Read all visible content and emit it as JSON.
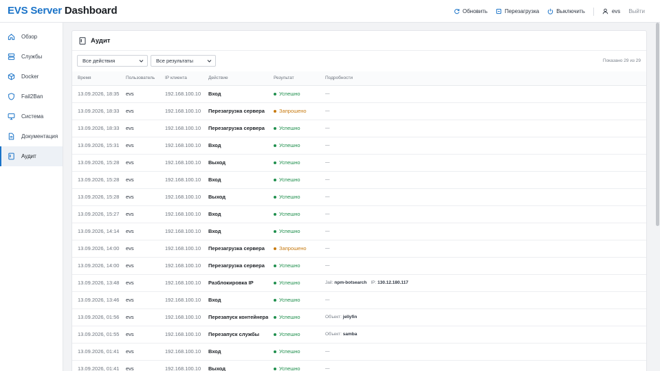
{
  "app": {
    "brand_part1": "EVS Server",
    "brand_part2": "Dashboard"
  },
  "topbar": {
    "refresh": "Обновить",
    "restart": "Перезагрузка",
    "shutdown": "Выключить",
    "user": "evs",
    "logout": "Выйти"
  },
  "sidebar": {
    "items": [
      {
        "label": "Обзор",
        "icon": "home-icon"
      },
      {
        "label": "Службы",
        "icon": "servers-icon"
      },
      {
        "label": "Docker",
        "icon": "box-icon"
      },
      {
        "label": "Fail2Ban",
        "icon": "shield-icon"
      },
      {
        "label": "Система",
        "icon": "monitor-icon"
      },
      {
        "label": "Документация",
        "icon": "document-icon"
      },
      {
        "label": "Аудит",
        "icon": "audit-icon"
      }
    ],
    "active_index": 6
  },
  "audit": {
    "title": "Аудит",
    "filter_actions": "Все действия",
    "filter_results": "Все результаты",
    "shown": "Показано 29 из 29",
    "columns": [
      "Время",
      "Пользователь",
      "IP клиента",
      "Действие",
      "Результат",
      "Подробности"
    ],
    "rows": [
      {
        "time": "13.09.2026, 18:35",
        "user": "evs",
        "ip": "192.168.100.10",
        "action": "Вход",
        "result": "Успешно",
        "status": "ok",
        "details": [
          {
            "text": "—"
          }
        ]
      },
      {
        "time": "13.09.2026, 18:33",
        "user": "evs",
        "ip": "192.168.100.10",
        "action": "Перезагрузка сервера",
        "result": "Запрошено",
        "status": "req",
        "details": [
          {
            "text": "—"
          }
        ]
      },
      {
        "time": "13.09.2026, 18:33",
        "user": "evs",
        "ip": "192.168.100.10",
        "action": "Перезагрузка сервера",
        "result": "Успешно",
        "status": "ok",
        "details": [
          {
            "text": "—"
          }
        ]
      },
      {
        "time": "13.09.2026, 15:31",
        "user": "evs",
        "ip": "192.168.100.10",
        "action": "Вход",
        "result": "Успешно",
        "status": "ok",
        "details": [
          {
            "text": "—"
          }
        ]
      },
      {
        "time": "13.09.2026, 15:28",
        "user": "evs",
        "ip": "192.168.100.10",
        "action": "Выход",
        "result": "Успешно",
        "status": "ok",
        "details": [
          {
            "text": "—"
          }
        ]
      },
      {
        "time": "13.09.2026, 15:28",
        "user": "evs",
        "ip": "192.168.100.10",
        "action": "Вход",
        "result": "Успешно",
        "status": "ok",
        "details": [
          {
            "text": "—"
          }
        ]
      },
      {
        "time": "13.09.2026, 15:28",
        "user": "evs",
        "ip": "192.168.100.10",
        "action": "Выход",
        "result": "Успешно",
        "status": "ok",
        "details": [
          {
            "text": "—"
          }
        ]
      },
      {
        "time": "13.09.2026, 15:27",
        "user": "evs",
        "ip": "192.168.100.10",
        "action": "Вход",
        "result": "Успешно",
        "status": "ok",
        "details": [
          {
            "text": "—"
          }
        ]
      },
      {
        "time": "13.09.2026, 14:14",
        "user": "evs",
        "ip": "192.168.100.10",
        "action": "Вход",
        "result": "Успешно",
        "status": "ok",
        "details": [
          {
            "text": "—"
          }
        ]
      },
      {
        "time": "13.09.2026, 14:00",
        "user": "evs",
        "ip": "192.168.100.10",
        "action": "Перезагрузка сервера",
        "result": "Запрошено",
        "status": "req",
        "details": [
          {
            "text": "—"
          }
        ]
      },
      {
        "time": "13.09.2026, 14:00",
        "user": "evs",
        "ip": "192.168.100.10",
        "action": "Перезагрузка сервера",
        "result": "Успешно",
        "status": "ok",
        "details": [
          {
            "text": "—"
          }
        ]
      },
      {
        "time": "13.09.2026, 13:48",
        "user": "evs",
        "ip": "192.168.100.10",
        "action": "Разблокировка IP",
        "result": "Успешно",
        "status": "ok",
        "details": [
          {
            "key": "Jail:",
            "val": "npm-botsearch"
          },
          {
            "key": "IP:",
            "val": "130.12.180.117"
          }
        ]
      },
      {
        "time": "13.09.2026, 13:46",
        "user": "evs",
        "ip": "192.168.100.10",
        "action": "Вход",
        "result": "Успешно",
        "status": "ok",
        "details": [
          {
            "text": "—"
          }
        ]
      },
      {
        "time": "13.09.2026, 01:56",
        "user": "evs",
        "ip": "192.168.100.10",
        "action": "Перезапуск контейнера",
        "result": "Успешно",
        "status": "ok",
        "details": [
          {
            "key": "Объект:",
            "val": "jellyfin"
          }
        ]
      },
      {
        "time": "13.09.2026, 01:55",
        "user": "evs",
        "ip": "192.168.100.10",
        "action": "Перезапуск службы",
        "result": "Успешно",
        "status": "ok",
        "details": [
          {
            "key": "Объект:",
            "val": "samba"
          }
        ]
      },
      {
        "time": "13.09.2026, 01:41",
        "user": "evs",
        "ip": "192.168.100.10",
        "action": "Вход",
        "result": "Успешно",
        "status": "ok",
        "details": [
          {
            "text": "—"
          }
        ]
      },
      {
        "time": "13.09.2026, 01:41",
        "user": "evs",
        "ip": "192.168.100.10",
        "action": "Выход",
        "result": "Успешно",
        "status": "ok",
        "details": [
          {
            "text": "—"
          }
        ]
      }
    ]
  },
  "colors": {
    "accent": "#1a73c8",
    "ok": "#1f8f4d",
    "requested": "#c77a10"
  }
}
